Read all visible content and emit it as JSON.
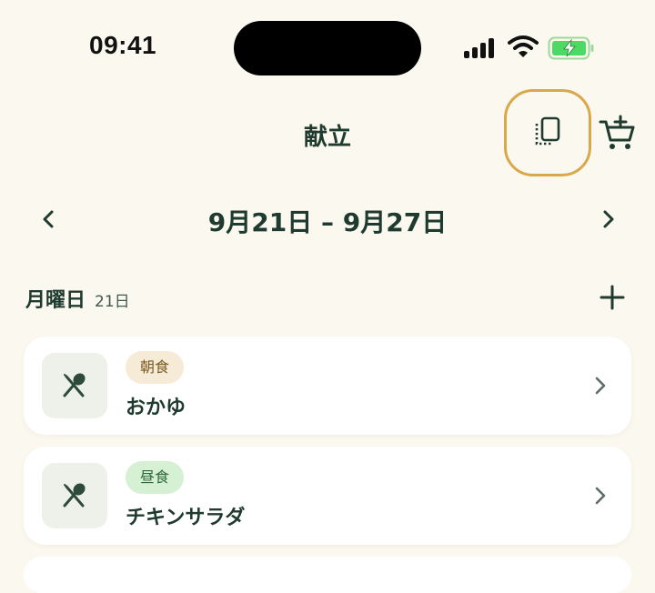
{
  "status": {
    "time": "09:41"
  },
  "header": {
    "title": "献立",
    "copy_icon": "copy-pages-icon",
    "cart_icon": "cart-add-icon"
  },
  "week": {
    "label": "9月21日 – 9月27日"
  },
  "day": {
    "name": "月曜日",
    "date": "21日"
  },
  "meals": [
    {
      "tag": "朝食",
      "name": "おかゆ",
      "icon": "utensils-icon"
    },
    {
      "tag": "昼食",
      "name": "チキンサラダ",
      "icon": "utensils-icon"
    }
  ],
  "colors": {
    "accent": "#d9a84a",
    "primary": "#1f3a2e",
    "background": "#fbf8f0",
    "battery": "#4cd964"
  }
}
